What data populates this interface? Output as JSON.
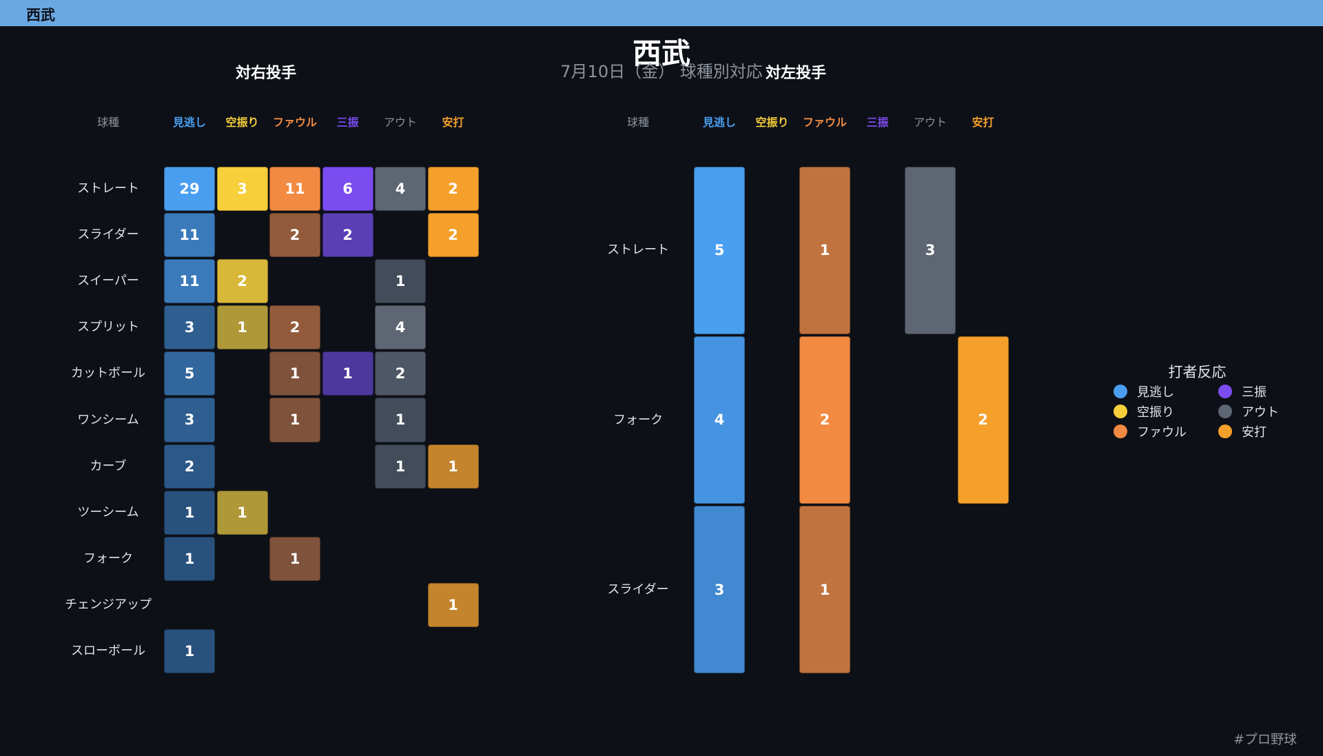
{
  "header": {
    "title": "西武"
  },
  "main_title": "西武",
  "subtitle": "7月10日（金） 球種別対応",
  "footer": {
    "hashtag": "#プロ野球"
  },
  "legend": {
    "title": "打者反応",
    "items": [
      {
        "label": "見逃し",
        "color": "#4a9ef0"
      },
      {
        "label": "三振",
        "color": "#7b4cf0"
      },
      {
        "label": "空振り",
        "color": "#f7cf3a"
      },
      {
        "label": "アウト",
        "color": "#5e6673"
      },
      {
        "label": "ファウル",
        "color": "#f28a42"
      },
      {
        "label": "安打",
        "color": "#f5a02a"
      }
    ]
  },
  "chart_data": [
    {
      "type": "heatmap",
      "title": "対右投手",
      "row_header": "球種",
      "columns": [
        "見逃し",
        "空振り",
        "ファウル",
        "三振",
        "アウト",
        "安打"
      ],
      "column_colors": [
        "#4a9ef0",
        "#f7cf3a",
        "#f28a42",
        "#7b4cf0",
        "#5e6673",
        "#f5a02a"
      ],
      "rows": [
        "ストレート",
        "スライダー",
        "スイーパー",
        "スプリット",
        "カットボール",
        "ワンシーム",
        "カーブ",
        "ツーシーム",
        "フォーク",
        "チェンジアップ",
        "スローボール"
      ],
      "values": [
        [
          29,
          3,
          11,
          6,
          4,
          2
        ],
        [
          11,
          null,
          2,
          2,
          null,
          2
        ],
        [
          11,
          2,
          null,
          null,
          1,
          null
        ],
        [
          3,
          1,
          2,
          null,
          4,
          null
        ],
        [
          5,
          null,
          1,
          1,
          2,
          null
        ],
        [
          3,
          null,
          1,
          null,
          1,
          null
        ],
        [
          2,
          null,
          null,
          null,
          1,
          1
        ],
        [
          1,
          1,
          null,
          null,
          null,
          null
        ],
        [
          1,
          null,
          1,
          null,
          null,
          null
        ],
        [
          null,
          null,
          null,
          null,
          null,
          1
        ],
        [
          1,
          null,
          null,
          null,
          null,
          null
        ]
      ]
    },
    {
      "type": "heatmap",
      "title": "対左投手",
      "row_header": "球種",
      "columns": [
        "見逃し",
        "空振り",
        "ファウル",
        "三振",
        "アウト",
        "安打"
      ],
      "column_colors": [
        "#4a9ef0",
        "#f7cf3a",
        "#f28a42",
        "#7b4cf0",
        "#5e6673",
        "#f5a02a"
      ],
      "rows": [
        "ストレート",
        "フォーク",
        "スライダー"
      ],
      "values": [
        [
          5,
          null,
          1,
          null,
          3,
          null
        ],
        [
          4,
          null,
          2,
          null,
          null,
          2
        ],
        [
          3,
          null,
          1,
          null,
          null,
          null
        ]
      ]
    }
  ]
}
